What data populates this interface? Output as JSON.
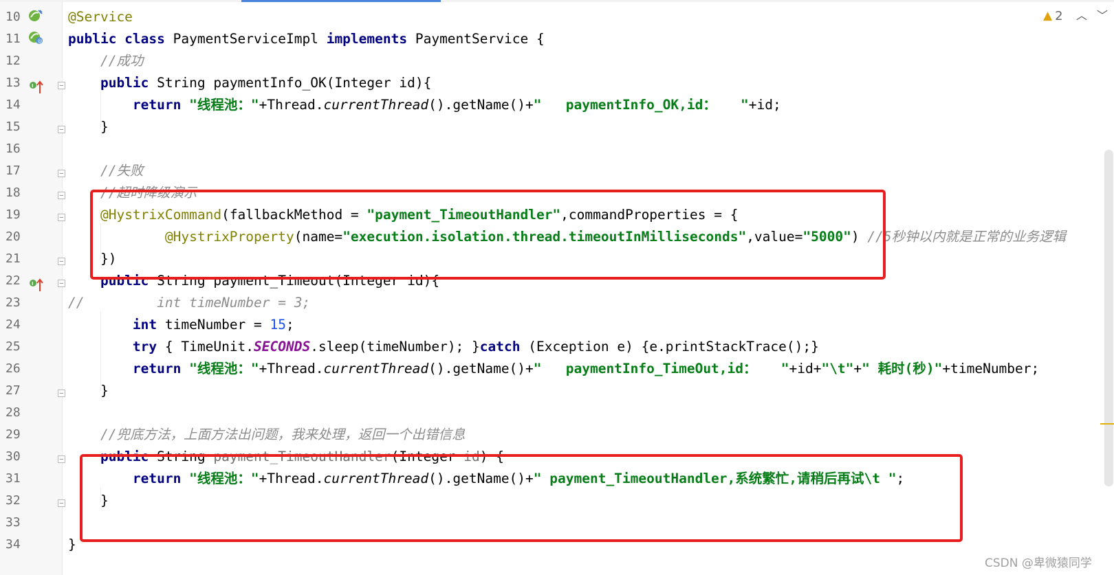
{
  "status": {
    "warning_count": "2",
    "warning_icon": "warning-triangle-icon",
    "nav_up_icon": "chevron-up-icon",
    "nav_down_icon": "chevron-down-icon"
  },
  "watermark": "CSDN @卑微猿同学",
  "highlight_color": "#e61e1e",
  "gutter_icons": {
    "l10": "spring-bean-icon",
    "l11": "spring-service-icon",
    "l13": "implements-method-icon",
    "l22": "implements-method-icon"
  },
  "lines": [
    {
      "n": "10",
      "t": [
        "@Service"
      ]
    },
    {
      "n": "11",
      "t": [
        "public class",
        " PaymentServiceImpl ",
        "implements",
        " PaymentService {"
      ]
    },
    {
      "n": "12",
      "t": [
        "    ",
        "//成功"
      ]
    },
    {
      "n": "13",
      "t": [
        "    ",
        "public",
        " String paymentInfo_OK(Integer id){"
      ]
    },
    {
      "n": "14",
      "t": [
        "        ",
        "return",
        " ",
        "\"线程池：\"",
        "+Thread.",
        "currentThread",
        "().getName()+",
        "\"   paymentInfo_OK,id：   \"",
        "+id;"
      ]
    },
    {
      "n": "15",
      "t": [
        "    }"
      ]
    },
    {
      "n": "16",
      "t": [
        ""
      ]
    },
    {
      "n": "17",
      "t": [
        "    ",
        "//失败"
      ]
    },
    {
      "n": "18",
      "t": [
        "    ",
        "//超时降级演示"
      ]
    },
    {
      "n": "19",
      "t": [
        "    ",
        "@HystrixCommand",
        "(fallbackMethod = ",
        "\"payment_TimeoutHandler\"",
        ",commandProperties = {"
      ]
    },
    {
      "n": "20",
      "t": [
        "            ",
        "@HystrixProperty",
        "(name=",
        "\"execution.isolation.thread.timeoutInMilliseconds\"",
        ",value=",
        "\"5000\"",
        ") ",
        "//5秒钟以内就是正常的业务逻辑"
      ]
    },
    {
      "n": "21",
      "t": [
        "    })"
      ]
    },
    {
      "n": "22",
      "t": [
        "    ",
        "public",
        " String payment_Timeout(Integer id){"
      ]
    },
    {
      "n": "23",
      "t": [
        "//         int timeNumber = 3;"
      ]
    },
    {
      "n": "24",
      "t": [
        "        ",
        "int",
        " timeNumber = ",
        "15",
        ";"
      ]
    },
    {
      "n": "25",
      "t": [
        "        ",
        "try",
        " { TimeUnit.",
        "SECONDS",
        ".sleep(timeNumber); }",
        "catch",
        " (Exception e) {e.printStackTrace();}"
      ]
    },
    {
      "n": "26",
      "t": [
        "        ",
        "return",
        " ",
        "\"线程池：\"",
        "+Thread.",
        "currentThread",
        "().getName()+",
        "\"   paymentInfo_TimeOut,id：   \"",
        "+id+",
        "\"\\t\"",
        "+",
        "\" 耗时(秒)\"",
        "+timeNumber;"
      ]
    },
    {
      "n": "27",
      "t": [
        "    }"
      ]
    },
    {
      "n": "28",
      "t": [
        ""
      ]
    },
    {
      "n": "29",
      "t": [
        "    ",
        "//兜底方法，上面方法出问题，我来处理，返回一个出错信息"
      ]
    },
    {
      "n": "30",
      "t": [
        "    ",
        "public",
        " String ",
        "payment_TimeoutHandler",
        "(Integer ",
        "id",
        ") {"
      ]
    },
    {
      "n": "31",
      "t": [
        "        ",
        "return",
        " ",
        "\"线程池：\"",
        "+Thread.",
        "currentThread",
        "().getName()+",
        "\" payment_TimeoutHandler,系统繁忙,请稍后再试\\t \"",
        ";"
      ]
    },
    {
      "n": "32",
      "t": [
        "    }"
      ]
    },
    {
      "n": "33",
      "t": [
        ""
      ]
    },
    {
      "n": "34",
      "t": [
        "}"
      ]
    }
  ]
}
